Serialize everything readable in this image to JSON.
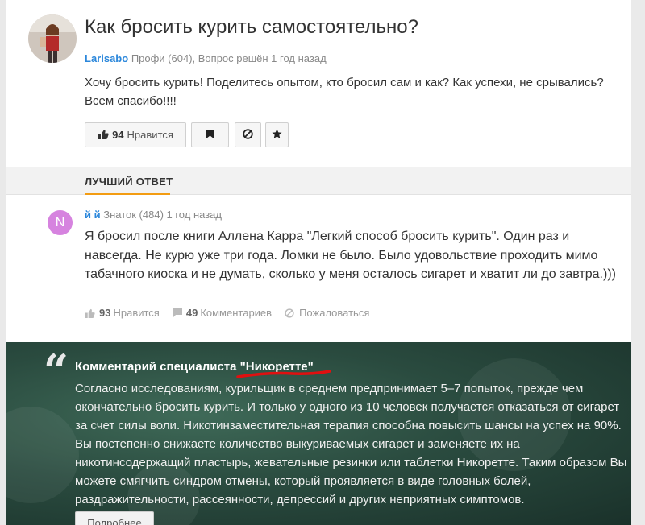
{
  "question": {
    "title": "Как бросить курить самостоятельно?",
    "author": "Larisabo",
    "meta": "Профи (604), Вопрос решён 1 год назад",
    "text": "Хочу бросить курить! Поделитесь опытом, кто бросил сам и как? Как успехи, не срывались? Всем спасибо!!!!",
    "like_count": "94",
    "like_label": "Нравится"
  },
  "best_answer": {
    "section_label": "ЛУЧШИЙ ОТВЕТ",
    "avatar_letter": "N",
    "author": "й й",
    "meta": "Знаток (484) 1 год назад",
    "text": "Я бросил после книги Аллена Карра \"Легкий способ бросить курить\". Один раз и навсегда. Не курю уже три года. Ломки не было. Было удовольствие проходить мимо табачного киоска и не думать, сколько у меня осталось сигарет и хватит ли до завтра.)))",
    "like_count": "93",
    "like_label": "Нравится",
    "comments_count": "49",
    "comments_label": "Комментариев",
    "report_label": "Пожаловаться"
  },
  "expert": {
    "title_prefix": "Комментарий специалиста ",
    "brand": "\"Никоретте\"",
    "text": "Согласно исследованиям, курильщик в среднем предпринимает 5–7 попыток, прежде чем окончательно бросить курить. И только у одного из 10 человек получается отказаться от сигарет за счет силы воли. Никотинзаместительная терапия способна повысить шансы на успех на 90%. Вы постепенно снижаете количество выкуриваемых сигарет и заменяете их на никотинсодержащий пластырь, жевательные резинки или таблетки Никоретте. Таким образом Вы можете смягчить синдром отмены, который проявляется в виде головных болей, раздражительности, рассеянности, депрессий и других неприятных симптомов.",
    "more_label": "Подробнее"
  },
  "icons": {
    "like": "thumbs-up-icon",
    "bookmark": "bookmark-icon",
    "block": "block-icon",
    "star": "star-icon",
    "comment": "comment-icon",
    "report": "report-icon"
  },
  "colors": {
    "author_link": "#2b87db",
    "best_underline": "#f39c12",
    "avatar_bg": "#d683df",
    "expert_bg": "#2a4b3f",
    "brand_underline": "#e01010"
  }
}
